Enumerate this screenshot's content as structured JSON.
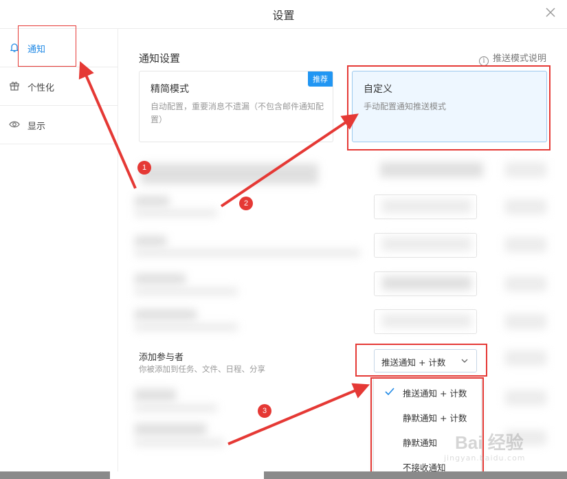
{
  "window": {
    "title": "设置"
  },
  "sidebar": {
    "items": [
      {
        "label": "通知",
        "icon": "bell-icon",
        "active": true
      },
      {
        "label": "个性化",
        "icon": "gift-icon",
        "active": false
      },
      {
        "label": "显示",
        "icon": "eye-icon",
        "active": false
      }
    ]
  },
  "main": {
    "section_title": "通知设置",
    "help_label": "推送模式说明",
    "modes": [
      {
        "title": "精简模式",
        "description": "自动配置，重要消息不遗漏（不包含邮件通知配置）",
        "badge": "推荐"
      },
      {
        "title": "自定义",
        "description": "手动配置通知推送模式",
        "selected": true
      }
    ],
    "add_participant": {
      "title": "添加参与者",
      "description": "你被添加到任务、文件、日程、分享",
      "selected_value": "推送通知 + 计数"
    },
    "dropdown_options": [
      {
        "label": "推送通知 + 计数",
        "checked": true
      },
      {
        "label": "静默通知 + 计数",
        "checked": false
      },
      {
        "label": "静默通知",
        "checked": false
      },
      {
        "label": "不接收通知",
        "checked": false
      }
    ]
  },
  "annotations": {
    "numbers": [
      "1",
      "2",
      "3"
    ],
    "color": "#e53935"
  },
  "watermark": {
    "brand": "Bai 经验",
    "sub": "jingyan.baidu.com"
  },
  "colors": {
    "accent": "#1e88e5",
    "badge": "#2196f3",
    "selected_card_bg": "#eef7ff"
  }
}
